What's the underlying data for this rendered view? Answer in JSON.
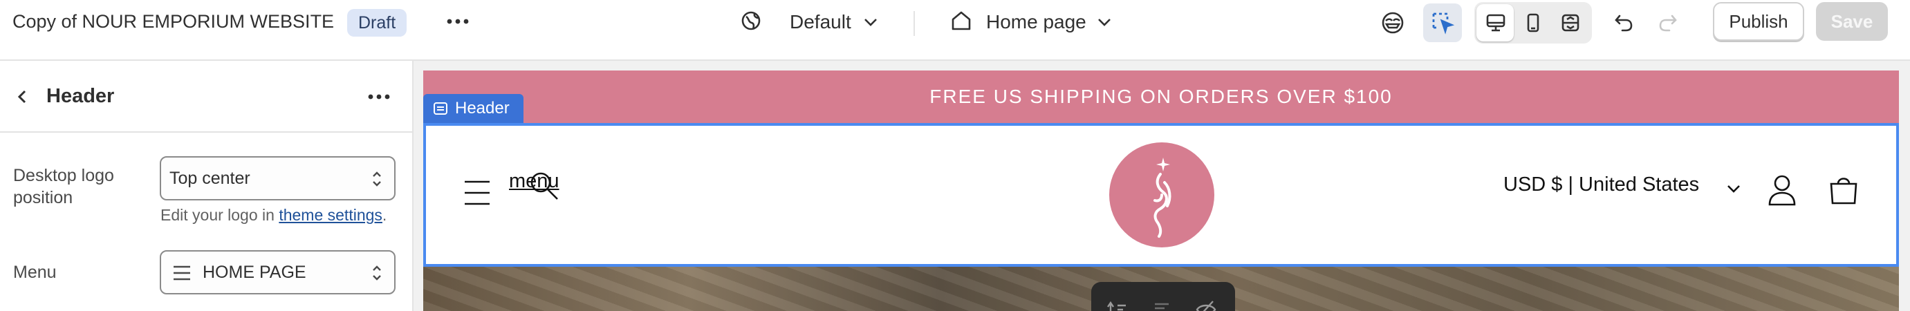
{
  "topbar": {
    "store_name": "Copy of NOUR EMPORIUM WEBSITE",
    "status_badge": "Draft",
    "theme_selector": "Default",
    "page_selector": "Home page",
    "publish_label": "Publish",
    "save_label": "Save",
    "icons": [
      "more-horizontal-icon",
      "globe-icon",
      "chevron-down-icon",
      "home-icon",
      "accessibility-icon",
      "select-element-icon",
      "desktop-icon",
      "mobile-icon",
      "fullwidth-icon",
      "undo-icon",
      "redo-icon"
    ]
  },
  "sidebar": {
    "title": "Header",
    "fields": {
      "logo_position": {
        "label": "Desktop logo position",
        "value": "Top center",
        "help_prefix": "Edit your logo in ",
        "help_link": "theme settings",
        "help_suffix": "."
      },
      "menu": {
        "label": "Menu",
        "value": "HOME PAGE"
      }
    }
  },
  "preview": {
    "announcement": "FREE US SHIPPING ON ORDERS OVER $100",
    "section_tag": "Header",
    "menu_label": "menu",
    "currency": "USD $ | United States"
  },
  "colors": {
    "brand_pink": "#d67d90",
    "selection_blue": "#4a8af0",
    "tag_blue": "#3a72d6"
  }
}
